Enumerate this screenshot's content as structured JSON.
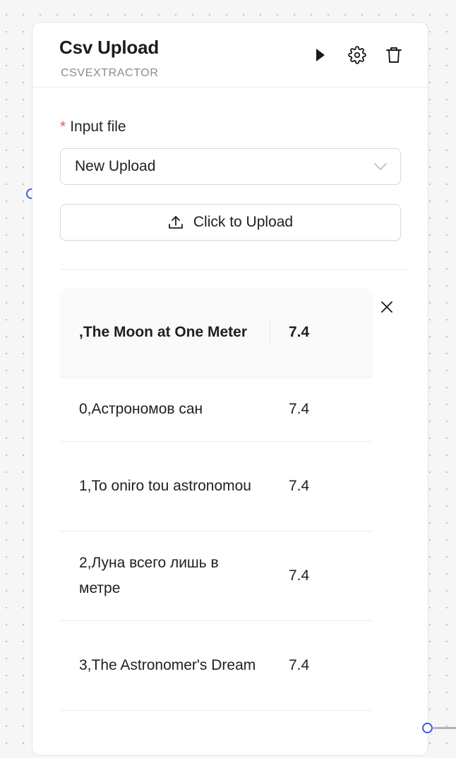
{
  "node": {
    "title": "Csv Upload",
    "subtitle": "CSVEXTRACTOR",
    "actions": [
      {
        "name": "play-icon"
      },
      {
        "name": "gear-icon"
      },
      {
        "name": "trash-icon"
      }
    ]
  },
  "form": {
    "required_mark": "*",
    "input_label": "Input file",
    "select_value": "New Upload",
    "select_icon": "chevron-down-icon",
    "upload_label": "Click to Upload",
    "upload_icon": "upload-icon"
  },
  "table": {
    "headers": [
      ",The Moon at One Meter",
      "7.4"
    ],
    "rows": [
      [
        "0,Астрономов сан",
        "7.4"
      ],
      [
        "1,To oniro tou astronomou",
        "7.4"
      ],
      [
        "2,Луна всего лишь в метре",
        "7.4"
      ],
      [
        "3,The Astronomer's Dream",
        "7.4"
      ]
    ],
    "close_icon": "close-icon"
  },
  "colors": {
    "accent": "#3b5bdb",
    "required": "#ff4d4f",
    "subtitle": "#8c8c8c",
    "canvas_background": "#f6f6f6"
  }
}
